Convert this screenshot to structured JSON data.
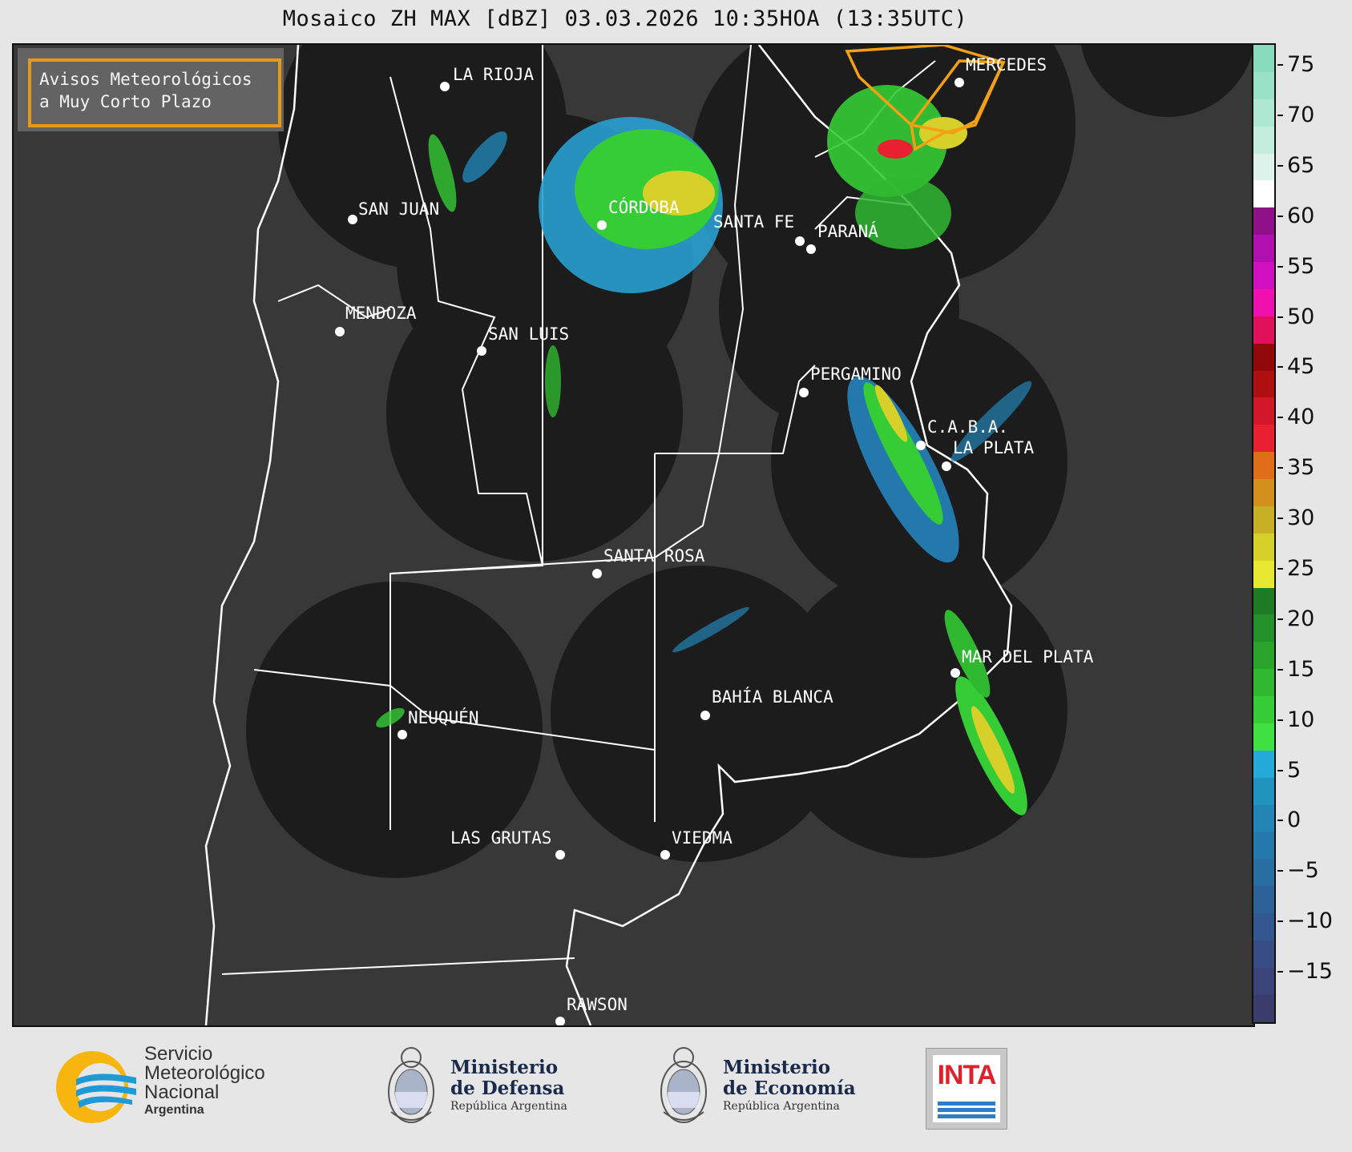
{
  "title": "Mosaico ZH MAX [dBZ] 03.03.2026 10:35HOA (13:35UTC)",
  "warning_box": {
    "line1": "Avisos Meteorológicos",
    "line2": "a Muy Corto Plazo"
  },
  "cities": [
    {
      "name": "LA RIOJA"
    },
    {
      "name": "SAN JUAN"
    },
    {
      "name": "CÓRDOBA"
    },
    {
      "name": "SANTA FE"
    },
    {
      "name": "PARANÁ"
    },
    {
      "name": "MENDOZA"
    },
    {
      "name": "SAN LUIS"
    },
    {
      "name": "PERGAMINO"
    },
    {
      "name": "C.A.B.A."
    },
    {
      "name": "LA PLATA"
    },
    {
      "name": "SANTA ROSA"
    },
    {
      "name": "MAR DEL PLATA"
    },
    {
      "name": "BAHÍA BLANCA"
    },
    {
      "name": "NEUQUÉN"
    },
    {
      "name": "LAS GRUTAS"
    },
    {
      "name": "VIEDMA"
    },
    {
      "name": "RAWSON"
    },
    {
      "name": "MERCEDES"
    }
  ],
  "colorbar": {
    "unit": "dBZ",
    "min": -20,
    "max": 77,
    "ticks": [
      "75",
      "70",
      "65",
      "60",
      "55",
      "50",
      "45",
      "40",
      "35",
      "30",
      "25",
      "20",
      "15",
      "10",
      "5",
      "0",
      "−5",
      "−10",
      "−15"
    ],
    "colors_bottom_to_top": [
      "#3a3d6b",
      "#3a4478",
      "#384d84",
      "#33578f",
      "#2d6299",
      "#286ea3",
      "#2479ac",
      "#2285b5",
      "#2193bf",
      "#25a9d8",
      "#40e040",
      "#36cc36",
      "#30b830",
      "#2aa42a",
      "#24902a",
      "#1f7c24",
      "#e8e830",
      "#d8d02a",
      "#c8b024",
      "#d4901c",
      "#e06e18",
      "#e82030",
      "#d01828",
      "#b01010",
      "#900808",
      "#e0105a",
      "#f010b0",
      "#d010c0",
      "#b010b0",
      "#90108a",
      "#ffffff",
      "#ddf4ea",
      "#c4eedc",
      "#aee8d0",
      "#9ae2c6",
      "#88dcbc"
    ]
  },
  "logos": {
    "smn": {
      "line1": "Servicio",
      "line2": "Meteorológico",
      "line3": "Nacional",
      "line4": "Argentina"
    },
    "defensa": {
      "line1": "Ministerio",
      "line2": "de Defensa",
      "line3": "República Argentina"
    },
    "economia": {
      "line1": "Ministerio",
      "line2": "de Economía",
      "line3": "República Argentina"
    },
    "inta": {
      "text": "INTA"
    }
  },
  "colors": {
    "background": "#e6e6e6",
    "map_bg": "#383838",
    "radar_disc": "#1c1c1c",
    "warning_orange": "#f3a014"
  }
}
